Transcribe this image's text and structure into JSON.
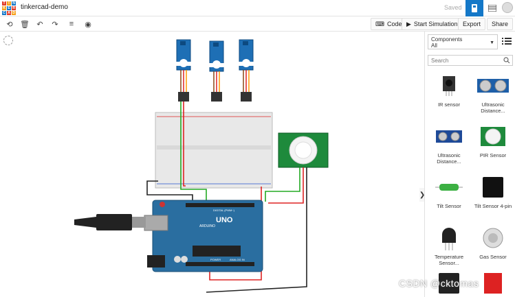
{
  "app": {
    "logo_letters": [
      "TIN",
      "KER",
      "CAD"
    ],
    "project_title": "tinkercad-demo",
    "save_status": "Saved"
  },
  "toolbar": {
    "code_label": "Code",
    "start_simulation_label": "Start Simulation",
    "export_label": "Export",
    "share_label": "Share"
  },
  "panel": {
    "category_label": "Components",
    "category_value": "All",
    "search_placeholder": "Search",
    "components": [
      {
        "label": "IR sensor"
      },
      {
        "label": "Ultrasonic Distance..."
      },
      {
        "label": "Ultrasonic Distance..."
      },
      {
        "label": "PIR Sensor"
      },
      {
        "label": "Tilt Sensor"
      },
      {
        "label": "Tilt Sensor 4-pin"
      },
      {
        "label": "Temperature Sensor..."
      },
      {
        "label": "Gas Sensor"
      }
    ]
  },
  "board": {
    "brand": "UNO",
    "maker": "ARDUINO",
    "digital_label": "DIGITAL (PWM~)",
    "power_label": "POWER",
    "analog_label": "ANALOG IN"
  },
  "watermark": "CSDN @cktomas",
  "colors": {
    "accent": "#1478c8",
    "arduino": "#2a6ea0",
    "servo": "#1e6fb5",
    "pir_board": "#1e8a3c",
    "wire_red": "#d22",
    "wire_green": "#2a2",
    "wire_black": "#222"
  }
}
